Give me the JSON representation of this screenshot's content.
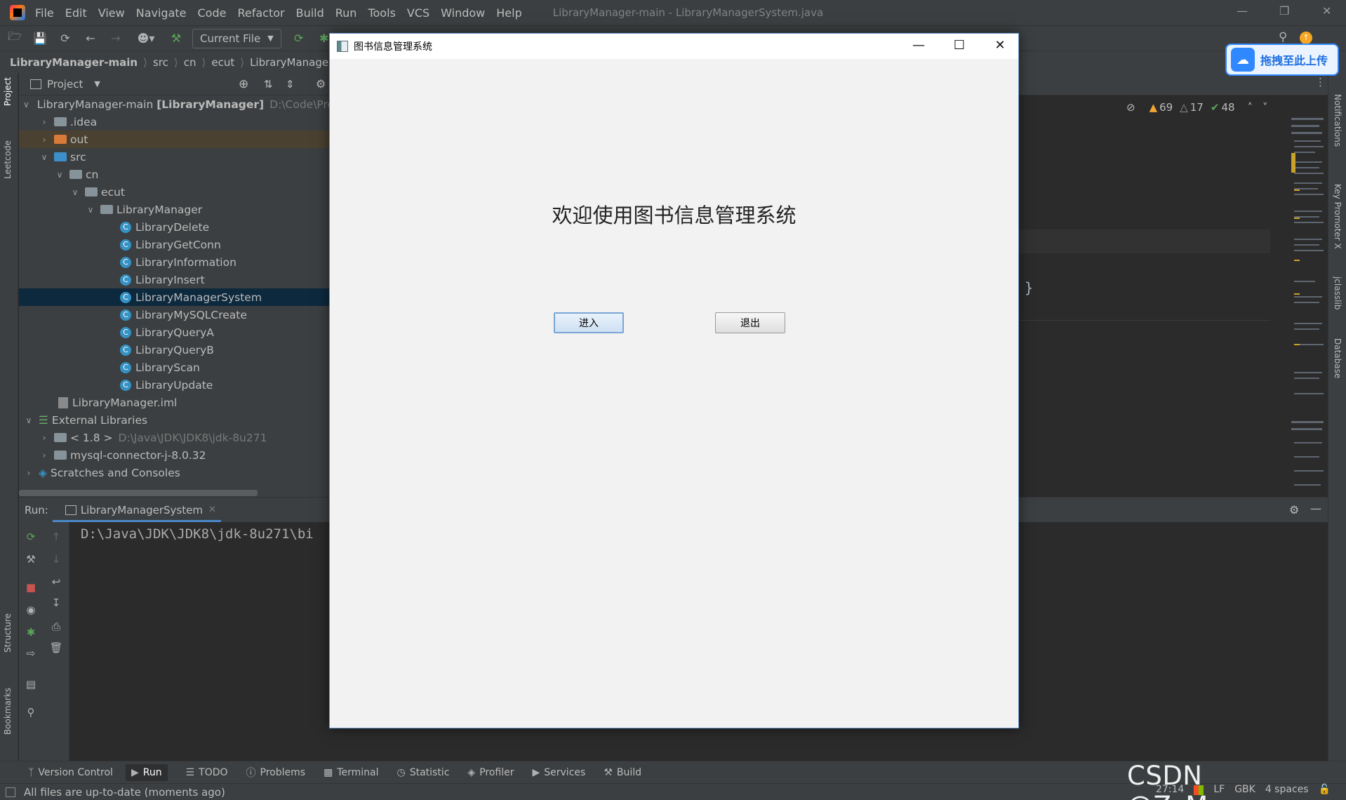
{
  "ide": {
    "menu": [
      "File",
      "Edit",
      "View",
      "Navigate",
      "Code",
      "Refactor",
      "Build",
      "Run",
      "Tools",
      "VCS",
      "Window",
      "Help"
    ],
    "window_title": "LibraryManager-main - LibraryManagerSystem.java",
    "run_config": "Current File",
    "breadcrumbs": [
      "LibraryManager-main",
      "src",
      "cn",
      "ecut",
      "LibraryManager"
    ]
  },
  "stripes": {
    "left_top": [
      "Project",
      "Leetcode"
    ],
    "left_bottom": [
      "Structure",
      "Bookmarks"
    ],
    "right": [
      "Notifications",
      "Key Promoter X",
      "jclasslib",
      "Database"
    ]
  },
  "project": {
    "title": "Project",
    "tree": [
      {
        "label": "LibraryManager-main",
        "bold_suffix": "[LibraryManager]",
        "path": "D:\\Code\\Pro",
        "type": "module"
      },
      {
        "label": ".idea",
        "type": "folder"
      },
      {
        "label": "out",
        "type": "folder-orange"
      },
      {
        "label": "src",
        "type": "folder-blue"
      },
      {
        "label": "cn",
        "type": "package"
      },
      {
        "label": "ecut",
        "type": "package"
      },
      {
        "label": "LibraryManager",
        "type": "package"
      },
      {
        "label": "LibraryDelete",
        "type": "class"
      },
      {
        "label": "LibraryGetConn",
        "type": "class"
      },
      {
        "label": "LibraryInformation",
        "type": "class"
      },
      {
        "label": "LibraryInsert",
        "type": "class"
      },
      {
        "label": "LibraryManagerSystem",
        "type": "class"
      },
      {
        "label": "LibraryMySQLCreate",
        "type": "class"
      },
      {
        "label": "LibraryQueryA",
        "type": "class"
      },
      {
        "label": "LibraryQueryB",
        "type": "class"
      },
      {
        "label": "LibraryScan",
        "type": "class"
      },
      {
        "label": "LibraryUpdate",
        "type": "class"
      },
      {
        "label": "LibraryManager.iml",
        "type": "file"
      },
      {
        "label": "External Libraries",
        "type": "libs"
      },
      {
        "label": "< 1.8 >",
        "path": "D:\\Java\\JDK\\JDK8\\jdk-8u271",
        "type": "jdk"
      },
      {
        "label": "mysql-connector-j-8.0.32",
        "type": "jar"
      },
      {
        "label": "Scratches and Consoles",
        "type": "scratch"
      }
    ]
  },
  "inspection": {
    "warnings": "69",
    "weak_warnings": "17",
    "ok": "48"
  },
  "editor": {
    "brace": "}"
  },
  "run": {
    "label": "Run:",
    "tab": "LibraryManagerSystem",
    "console_line": "D:\\Java\\JDK\\JDK8\\jdk-8u271\\bi"
  },
  "bottom_tabs": [
    "Version Control",
    "Run",
    "TODO",
    "Problems",
    "Terminal",
    "Statistic",
    "Profiler",
    "Services",
    "Build"
  ],
  "status": {
    "message": "All files are up-to-date (moments ago)",
    "position": "27:14",
    "line_sep": "LF",
    "encoding": "GBK",
    "indent": "4 spaces"
  },
  "watermark": "CSDN @ZzMemory",
  "pan_button": {
    "label": "拖拽至此上传"
  },
  "dialog": {
    "title": "图书信息管理系统",
    "heading": "欢迎使用图书信息管理系统",
    "enter_button": "进入",
    "exit_button": "退出"
  },
  "colors": {
    "ide_bg": "#2b2b2b",
    "panel": "#3c3f41",
    "selection": "#0d293e",
    "dialog_bg": "#f2f2f2",
    "accent": "#2f88ff"
  }
}
